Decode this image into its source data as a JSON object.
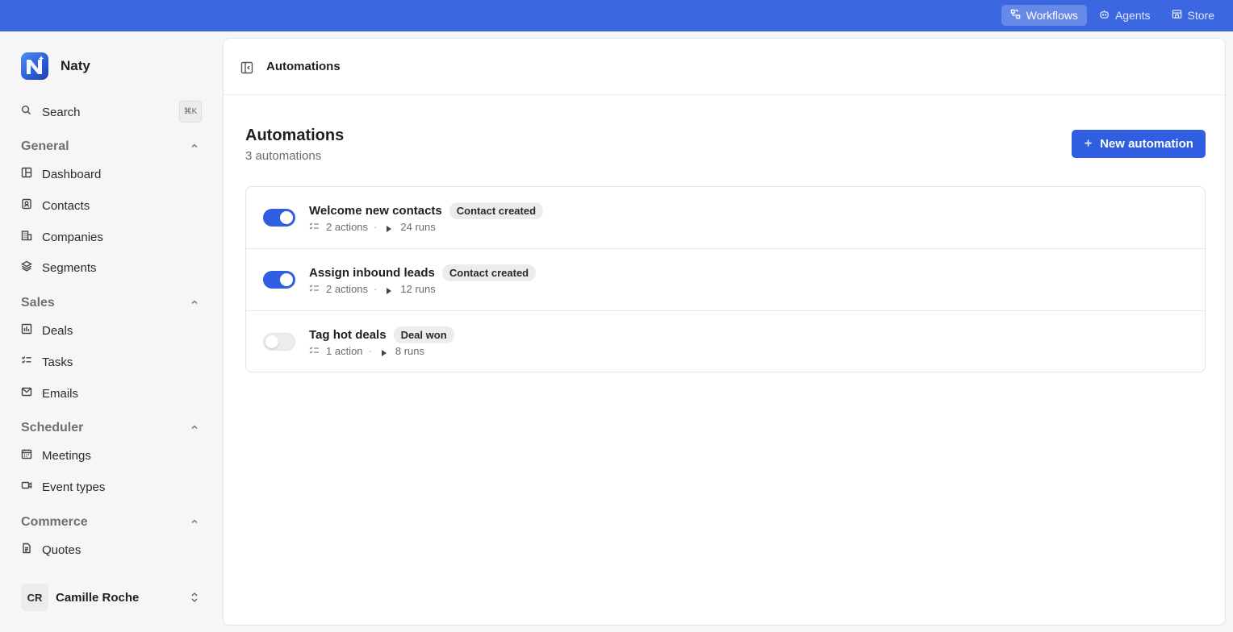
{
  "topnav": [
    {
      "label": "Workflows",
      "icon": "workflow-icon",
      "active": true
    },
    {
      "label": "Agents",
      "icon": "agent-icon",
      "active": false
    },
    {
      "label": "Store",
      "icon": "store-icon",
      "active": false
    }
  ],
  "brand": {
    "name": "Naty"
  },
  "search": {
    "label": "Search",
    "shortcut": "⌘K"
  },
  "sections": {
    "general": "General",
    "sales": "Sales",
    "scheduler": "Scheduler",
    "commerce": "Commerce"
  },
  "nav": {
    "dashboard": "Dashboard",
    "contacts": "Contacts",
    "companies": "Companies",
    "segments": "Segments",
    "deals": "Deals",
    "tasks": "Tasks",
    "emails": "Emails",
    "meetings": "Meetings",
    "event_types": "Event types",
    "quotes": "Quotes"
  },
  "user": {
    "initials": "CR",
    "name": "Camille Roche"
  },
  "header": {
    "crumb": "Automations"
  },
  "page": {
    "title": "Automations",
    "subtitle": "3 automations",
    "new_button": "New automation"
  },
  "automations": [
    {
      "name": "Welcome new contacts",
      "trigger": "Contact created",
      "actions": "2 actions",
      "runs": "24 runs",
      "enabled": true
    },
    {
      "name": "Assign inbound leads",
      "trigger": "Contact created",
      "actions": "2 actions",
      "runs": "12 runs",
      "enabled": true
    },
    {
      "name": "Tag hot deals",
      "trigger": "Deal won",
      "actions": "1 action",
      "runs": "8 runs",
      "enabled": false
    }
  ],
  "colors": {
    "topbar": "#3b68e0",
    "accent": "#2f5fe0"
  }
}
